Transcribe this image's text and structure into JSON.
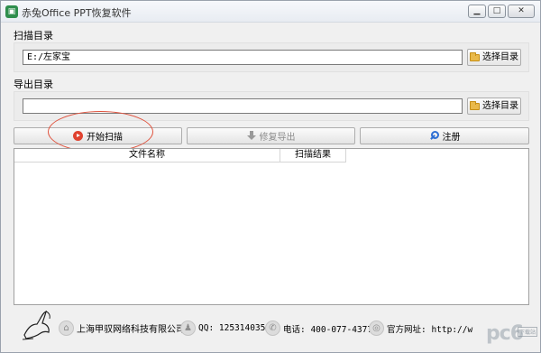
{
  "window": {
    "title": "赤兔Office PPT恢复软件",
    "app_icon": "app-icon",
    "controls": {
      "minimize": "▁",
      "maximize": "□",
      "close": "✕"
    }
  },
  "scan_section": {
    "label": "扫描目录",
    "path_value": "E:/左家宝",
    "browse_label": "选择目录"
  },
  "export_section": {
    "label": "导出目录",
    "path_value": "",
    "browse_label": "选择目录"
  },
  "actions": {
    "start_scan": "开始扫描",
    "repair_export": "修复导出",
    "register": "注册"
  },
  "file_list": {
    "columns": [
      "文件名称",
      "扫描结果"
    ],
    "rows": []
  },
  "footer": {
    "company": "上海甲驭网络科技有限公司",
    "qq": "QQ: 1253140355",
    "phone": "电话: 400-077-4377",
    "website": "官方网址: http://w"
  },
  "watermark": {
    "text": "pc6",
    "subtext": "下载站"
  },
  "colors": {
    "accent_red": "#e0422f",
    "key_blue": "#2e6fd4",
    "folder_yellow": "#e9b949",
    "app_green": "#2f8e4d"
  }
}
